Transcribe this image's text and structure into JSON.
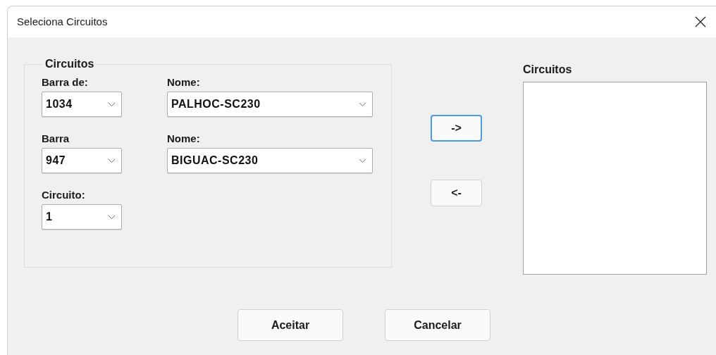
{
  "window": {
    "title": "Seleciona Circuitos"
  },
  "group": {
    "legend": "Circuitos",
    "rows": [
      {
        "fields": [
          {
            "label": "Barra de:",
            "value": "1034",
            "wide": false
          },
          {
            "label": "Nome:",
            "value": "PALHOC-SC230",
            "wide": true
          }
        ]
      },
      {
        "fields": [
          {
            "label": "Barra",
            "value": "947",
            "wide": false
          },
          {
            "label": "Nome:",
            "value": "BIGUAC-SC230",
            "wide": true
          }
        ]
      },
      {
        "fields": [
          {
            "label": "Circuito:",
            "value": "1",
            "wide": false
          }
        ]
      }
    ]
  },
  "move_buttons": [
    {
      "label": "->",
      "focused": true
    },
    {
      "label": "<-",
      "focused": false
    }
  ],
  "list": {
    "label": "Circuitos"
  },
  "buttons": [
    {
      "label": "Aceitar"
    },
    {
      "label": "Cancelar"
    }
  ]
}
